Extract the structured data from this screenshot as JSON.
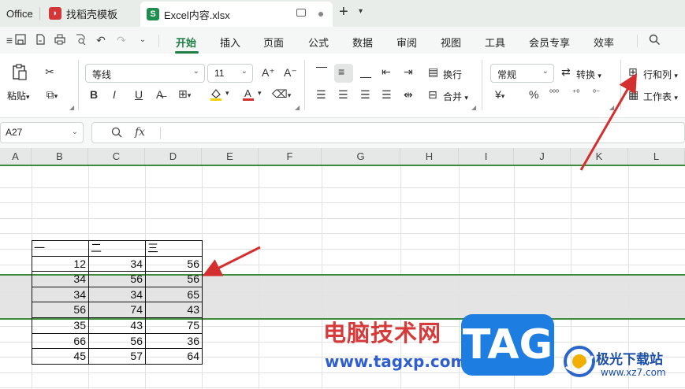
{
  "tabs": {
    "office_label": "Office",
    "template_label": "找稻壳模板",
    "file_label": "Excel内容.xlsx",
    "file_icon_letter": "S"
  },
  "menu": {
    "items": [
      "开始",
      "插入",
      "页面",
      "公式",
      "数据",
      "审阅",
      "视图",
      "工具",
      "会员专享",
      "效率"
    ],
    "active": "开始"
  },
  "ribbon": {
    "paste_label": "粘贴",
    "font_name": "等线",
    "font_size": "11",
    "wrap_label": "换行",
    "merge_label": "合并",
    "number_format": "常规",
    "convert_label": "转换",
    "rowcol_label": "行和列",
    "worksheet_label": "工作表",
    "bold_label": "B",
    "italic_label": "I",
    "underline_label": "U",
    "font_grow_label": "A⁺",
    "font_shrink_label": "A⁻",
    "currency_label": "¥",
    "percent_label": "%"
  },
  "formula_bar": {
    "cell_ref": "A27",
    "fx_label": "fx",
    "formula": ""
  },
  "columns": [
    "A",
    "B",
    "C",
    "D",
    "E",
    "F",
    "G",
    "H",
    "I",
    "J",
    "K",
    "L"
  ],
  "table": {
    "headers": [
      "一",
      "二",
      "三"
    ],
    "rows": [
      [
        "12",
        "34",
        "56"
      ],
      [
        "34",
        "56",
        "56"
      ],
      [
        "34",
        "34",
        "65"
      ],
      [
        "56",
        "74",
        "43"
      ],
      [
        "35",
        "43",
        "75"
      ],
      [
        "66",
        "56",
        "36"
      ],
      [
        "45",
        "57",
        "64"
      ]
    ]
  },
  "watermark": {
    "site_cn": "电脑技术网",
    "site_url": "www.tagxp.com",
    "tag": "TAG",
    "xz_name": "极光下载站",
    "xz_url": "www.xz7.com"
  },
  "colors": {
    "accent": "#1e7e44",
    "selection_line": "#3c8c3c",
    "annotation_arrow": "#d32f2f"
  }
}
